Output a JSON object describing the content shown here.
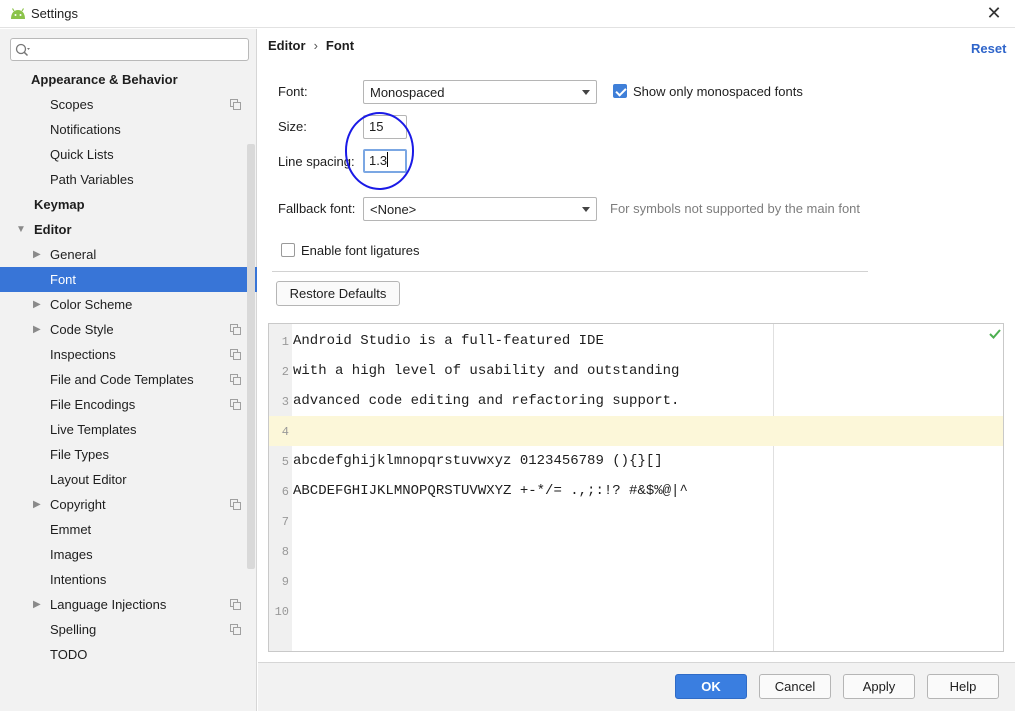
{
  "window": {
    "title": "Settings"
  },
  "search": {
    "placeholder": ""
  },
  "sidebar": {
    "items": [
      {
        "label": "Appearance & Behavior",
        "level": 0,
        "bold": true,
        "arrow": "",
        "proj": false
      },
      {
        "label": "Scopes",
        "level": 1,
        "proj": true
      },
      {
        "label": "Notifications",
        "level": 1
      },
      {
        "label": "Quick Lists",
        "level": 1
      },
      {
        "label": "Path Variables",
        "level": 1
      },
      {
        "label": "Keymap",
        "level": 0,
        "bold": true
      },
      {
        "label": "Editor",
        "level": 0,
        "bold": true,
        "arrow": "expanded"
      },
      {
        "label": "General",
        "level": 1,
        "arrow": "collapsed"
      },
      {
        "label": "Font",
        "level": 1,
        "selected": true
      },
      {
        "label": "Color Scheme",
        "level": 1,
        "arrow": "collapsed"
      },
      {
        "label": "Code Style",
        "level": 1,
        "arrow": "collapsed",
        "proj": true
      },
      {
        "label": "Inspections",
        "level": 1,
        "proj": true
      },
      {
        "label": "File and Code Templates",
        "level": 1,
        "proj": true
      },
      {
        "label": "File Encodings",
        "level": 1,
        "proj": true
      },
      {
        "label": "Live Templates",
        "level": 1
      },
      {
        "label": "File Types",
        "level": 1
      },
      {
        "label": "Layout Editor",
        "level": 1
      },
      {
        "label": "Copyright",
        "level": 1,
        "arrow": "collapsed",
        "proj": true
      },
      {
        "label": "Emmet",
        "level": 1
      },
      {
        "label": "Images",
        "level": 1
      },
      {
        "label": "Intentions",
        "level": 1
      },
      {
        "label": "Language Injections",
        "level": 1,
        "arrow": "collapsed",
        "proj": true
      },
      {
        "label": "Spelling",
        "level": 1,
        "proj": true
      },
      {
        "label": "TODO",
        "level": 1
      }
    ]
  },
  "breadcrumb": {
    "parent": "Editor",
    "separator": "›",
    "current": "Font"
  },
  "reset": {
    "label": "Reset"
  },
  "form": {
    "font_label": "Font:",
    "font_value": "Monospaced",
    "show_mono_label": "Show only monospaced fonts",
    "show_mono_checked": true,
    "size_label": "Size:",
    "size_value": "15",
    "line_spacing_label": "Line spacing:",
    "line_spacing_value": "1.3",
    "fallback_label": "Fallback font:",
    "fallback_value": "<None>",
    "fallback_hint": "For symbols not supported by the main font",
    "ligatures_label": "Enable font ligatures",
    "ligatures_checked": false
  },
  "restore_defaults": {
    "label": "Restore Defaults"
  },
  "preview": {
    "lines": [
      {
        "n": "1",
        "text": "Android Studio is a full-featured IDE"
      },
      {
        "n": "2",
        "text": "with a high level of usability and outstanding"
      },
      {
        "n": "3",
        "text": "advanced code editing and refactoring support."
      },
      {
        "n": "4",
        "text": ""
      },
      {
        "n": "5",
        "text": "abcdefghijklmnopqrstuvwxyz 0123456789 (){}[]"
      },
      {
        "n": "6",
        "text": "ABCDEFGHIJKLMNOPQRSTUVWXYZ +-*/= .,;:!? #&$%@|^"
      },
      {
        "n": "7",
        "text": ""
      },
      {
        "n": "8",
        "text": ""
      },
      {
        "n": "9",
        "text": ""
      },
      {
        "n": "10",
        "text": ""
      }
    ],
    "current_line": 3
  },
  "footer": {
    "ok": "OK",
    "cancel": "Cancel",
    "apply": "Apply",
    "help": "Help"
  },
  "colors": {
    "selection": "#3875d7",
    "accent": "#3a7ee0",
    "link": "#2f65ca",
    "annotation": "#1a1ae6"
  }
}
